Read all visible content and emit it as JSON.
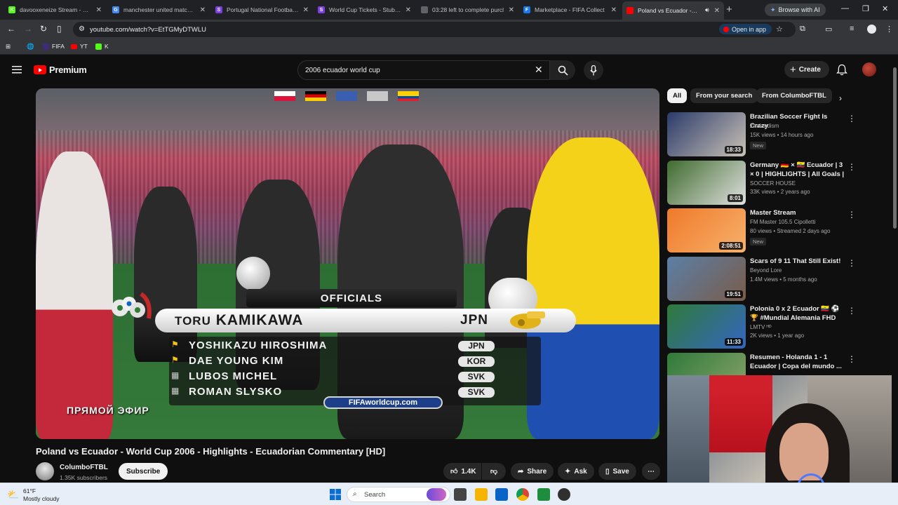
{
  "browser": {
    "tabs": [
      {
        "title": "davooxeneize Stream - Watc",
        "color": "#53fc18",
        "letter": "K"
      },
      {
        "title": "manchester united matches",
        "color": "#4285f4",
        "letter": "G"
      },
      {
        "title": "Portugal National Football T",
        "color": "#7b3fe4",
        "letter": "S"
      },
      {
        "title": "World Cup Tickets - StubHu",
        "color": "#7b3fe4",
        "letter": "S"
      },
      {
        "title": "03:28 left to complete purcl",
        "color": "#5f6368",
        "letter": ""
      },
      {
        "title": "Marketplace - FIFA Collect",
        "color": "#1877f2",
        "letter": "F"
      },
      {
        "title": "Poland vs Ecuador - Wo",
        "color": "#ff0000",
        "letter": "",
        "active": true
      }
    ],
    "ai_button": "Browse with AI",
    "url": "youtube.com/watch?v=EtTGMyDTWLU",
    "open_in_app": "Open in app",
    "bookmarks": [
      {
        "label": "FIFA",
        "color": "#3d2b7a"
      },
      {
        "label": "YT",
        "color": "#ff0000"
      },
      {
        "label": "K",
        "color": "#53fc18"
      }
    ]
  },
  "youtube": {
    "logo_text": "Premium",
    "search_query": "2006 ecuador world cup",
    "create_label": "Create",
    "video": {
      "title": "Poland vs Ecuador - World Cup 2006 - Highlights - Ecuadorian Commentary [HD]",
      "channel": "ColumboFTBL",
      "subscribers": "1.35K subscribers",
      "subscribe_label": "Subscribe",
      "likes": "1.4K",
      "share_label": "Share",
      "ask_label": "Ask",
      "save_label": "Save",
      "overlay": {
        "heading": "OFFICIALS",
        "referee_first": "TORU",
        "referee_last": "KAMIKAWA",
        "referee_country": "JPN",
        "assistants": [
          {
            "name": "YOSHIKAZU HIROSHIMA",
            "country": "JPN"
          },
          {
            "name": "DAE YOUNG KIM",
            "country": "KOR"
          },
          {
            "name": "LUBOS MICHEL",
            "country": "SVK"
          },
          {
            "name": "ROMAN SLYSKO",
            "country": "SVK"
          }
        ],
        "url_banner": "FIFAworldcup.com",
        "live_tag": "ПРЯМОЙ ЭФИР"
      }
    },
    "chips": [
      "All",
      "From your search",
      "From ColumboFTBL"
    ],
    "recommendations": [
      {
        "title": "Brazilian Soccer Fight Is Crazy",
        "channel": "Zealandism",
        "meta": "15K views • 14 hours ago",
        "badge": "New",
        "duration": "18:33",
        "c1": "#2b3a6b",
        "c2": "#c9c2b5"
      },
      {
        "title": "Germany 🇩🇪 × 🇪🇨 Ecuador | 3 × 0 | HIGHLIGHTS | All Goals | Wor...",
        "channel": "SOCCER HOUSE",
        "meta": "33K views • 2 years ago",
        "badge": "",
        "duration": "8:01",
        "c1": "#3f6b2e",
        "c2": "#e0e0e0"
      },
      {
        "title": "Master Stream",
        "channel": "FM Master 105.5 Cipolletti",
        "meta": "80 views • Streamed 2 days ago",
        "badge": "New",
        "duration": "2:08:51",
        "c1": "#f07a2a",
        "c2": "#f6b16b"
      },
      {
        "title": "Scars of 9 11 That Still Exist!",
        "channel": "Beyond Lore",
        "meta": "1.4M views • 5 months ago",
        "badge": "",
        "duration": "19:51",
        "c1": "#5b7fa6",
        "c2": "#7a5c4a"
      },
      {
        "title": "Polonia 0 x 2 Ecuador 🇪🇨 ⚽ 🏆 #Mundial Alemania FHD 🇪🇨 [...",
        "channel": "LMTV ᴴᴰ",
        "meta": "2K views • 1 year ago",
        "badge": "",
        "duration": "11:33",
        "c1": "#2f7a3a",
        "c2": "#3466c2"
      },
      {
        "title": "Resumen - Holanda 1 - 1 Ecuador | Copa del mundo ...",
        "channel": "",
        "meta": "",
        "badge": "",
        "duration": "",
        "c1": "#2f7a3a",
        "c2": "#8aa36a"
      }
    ]
  },
  "taskbar": {
    "temp": "61°F",
    "weather": "Mostly cloudy",
    "search_placeholder": "Search"
  }
}
